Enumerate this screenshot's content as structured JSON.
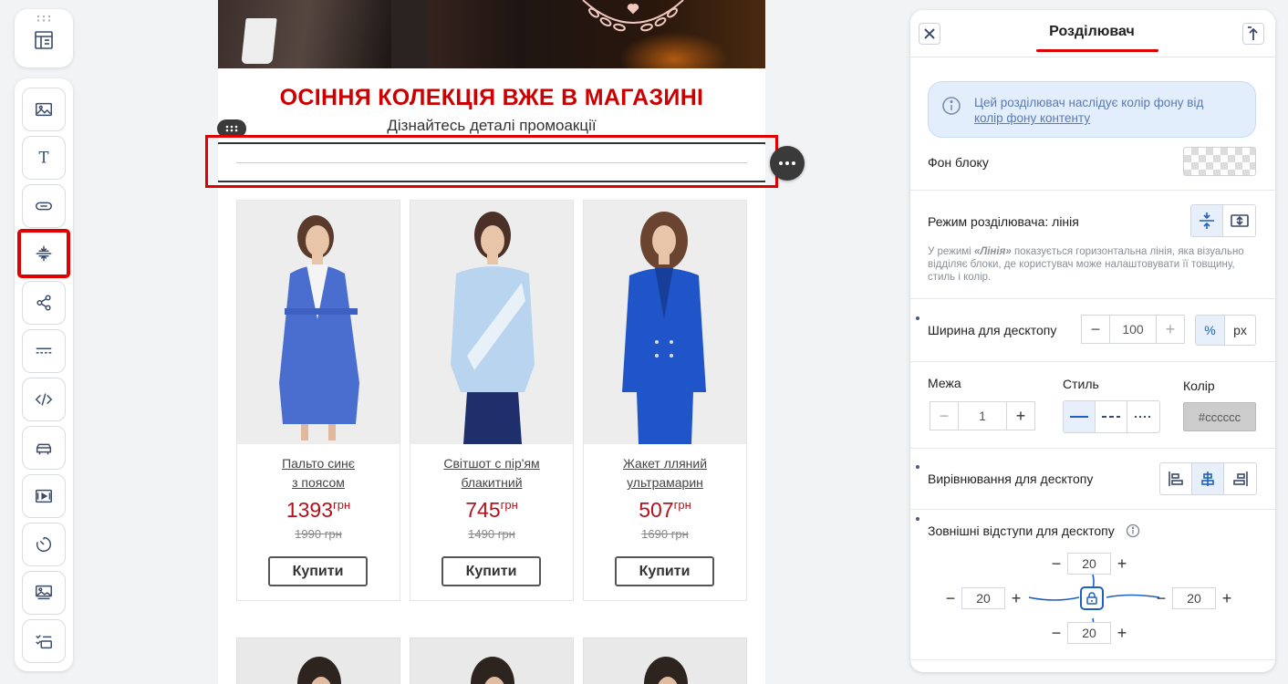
{
  "toolbar": {
    "top_icon": "layout-icon",
    "items": [
      {
        "icon": "image-icon"
      },
      {
        "icon": "text-icon",
        "glyph": "T"
      },
      {
        "icon": "button-icon"
      },
      {
        "icon": "divider-icon",
        "active": true
      },
      {
        "icon": "share-icon"
      },
      {
        "icon": "menu-lines-icon"
      },
      {
        "icon": "code-icon",
        "glyph": "</>"
      },
      {
        "icon": "product-icon"
      },
      {
        "icon": "video-icon"
      },
      {
        "icon": "timer-icon"
      },
      {
        "icon": "banner-icon"
      },
      {
        "icon": "checklist-icon"
      }
    ]
  },
  "email": {
    "headline": "ОСІННЯ КОЛЕКЦІЯ ВЖЕ В МАГАЗИНІ",
    "subline": "Дізнайтесь деталі промоакції",
    "divider_color": "#cccccc",
    "products": [
      {
        "name_line1": "Пальто синє",
        "name_line2": "з поясом",
        "price": "1393",
        "currency": "грн",
        "old_price": "1990 грн",
        "buy": "Купити"
      },
      {
        "name_line1": "Світшот с пір'ям",
        "name_line2": "блакитний",
        "price": "745",
        "currency": "грн",
        "old_price": "1490 грн",
        "buy": "Купити"
      },
      {
        "name_line1": "Жакет лляний",
        "name_line2": "ультрамарин",
        "price": "507",
        "currency": "грн",
        "old_price": "1690 грн",
        "buy": "Купити"
      }
    ]
  },
  "panel": {
    "title": "Розділювач",
    "info_text": "Цей розділювач наслідує колір фону від",
    "info_link": "колір фону контенту",
    "bg_label": "Фон блоку",
    "mode_label": "Режим розділювача: лінія",
    "hint_prefix": "У режимі ",
    "hint_mode": "«Лінія»",
    "hint_rest": " показується горизонтальна лінія, яка візуально відділяє блоки, де користувач може налаштовувати її товщину, стиль і колір.",
    "width_label": "Ширина для десктопу",
    "width_value": "100",
    "unit_percent": "%",
    "unit_px": "px",
    "border_label": "Межа",
    "border_value": "1",
    "style_label": "Стиль",
    "color_label": "Колір",
    "color_value": "#cccccc",
    "align_label": "Вирівнювання для десктопу",
    "margin_label": "Зовнішні відступи для десктопу",
    "margin_top": "20",
    "margin_left": "20",
    "margin_right": "20",
    "margin_bottom": "20",
    "accent_color": "#1f5fbf",
    "highlight_color": "#e00000"
  }
}
